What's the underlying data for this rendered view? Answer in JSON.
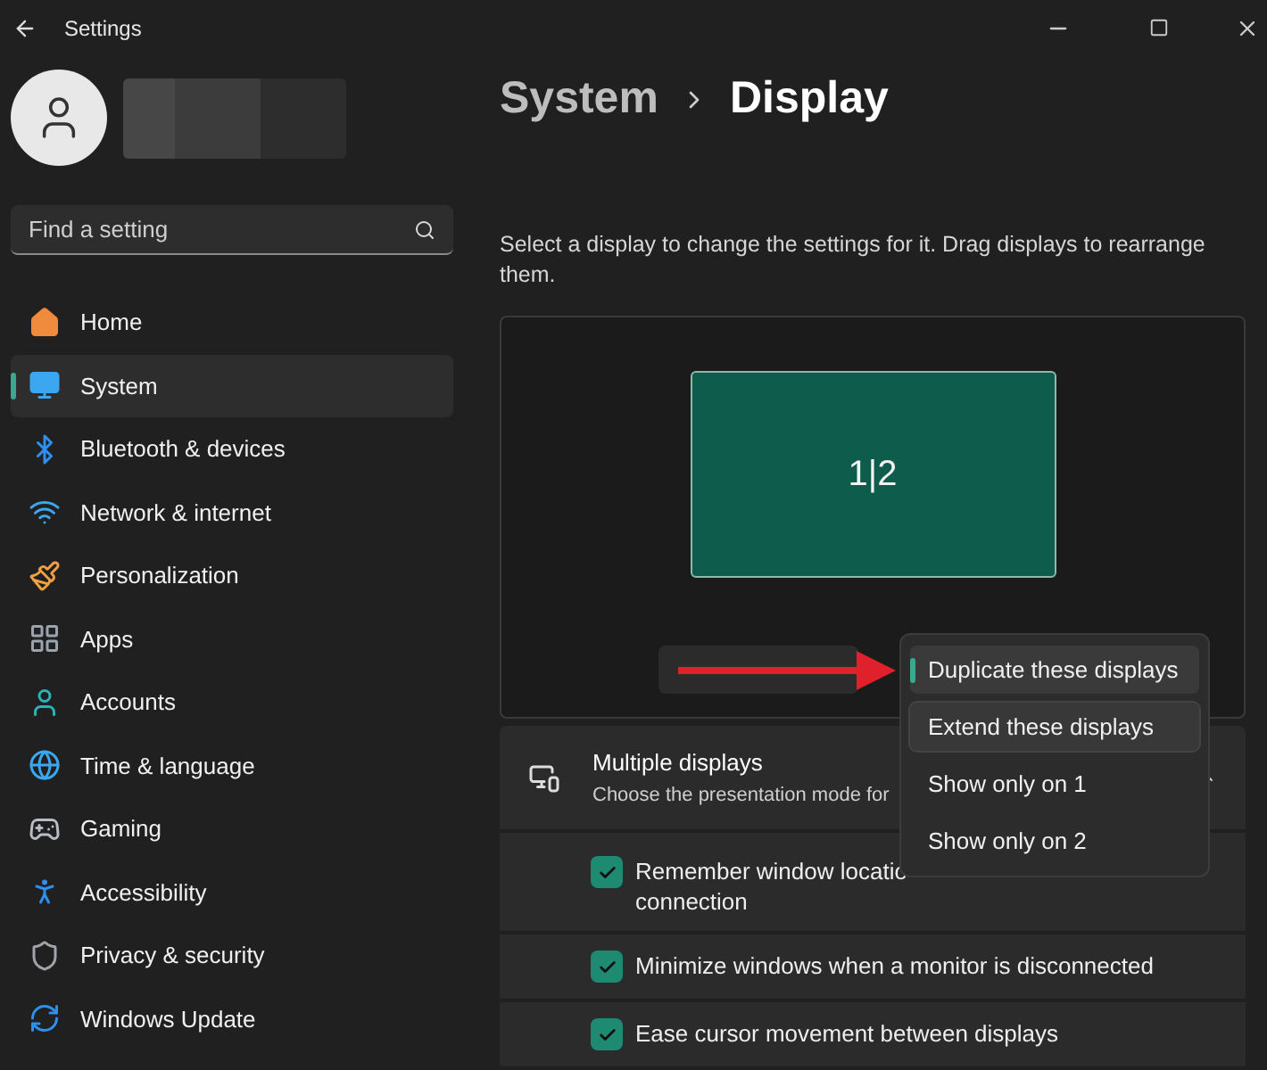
{
  "window": {
    "title": "Settings"
  },
  "search": {
    "placeholder": "Find a setting"
  },
  "sidebar": {
    "items": [
      {
        "label": "Home",
        "selected": false
      },
      {
        "label": "System",
        "selected": true
      },
      {
        "label": "Bluetooth & devices",
        "selected": false
      },
      {
        "label": "Network & internet",
        "selected": false
      },
      {
        "label": "Personalization",
        "selected": false
      },
      {
        "label": "Apps",
        "selected": false
      },
      {
        "label": "Accounts",
        "selected": false
      },
      {
        "label": "Time & language",
        "selected": false
      },
      {
        "label": "Gaming",
        "selected": false
      },
      {
        "label": "Accessibility",
        "selected": false
      },
      {
        "label": "Privacy & security",
        "selected": false
      },
      {
        "label": "Windows Update",
        "selected": false
      }
    ]
  },
  "breadcrumb": {
    "parent": "System",
    "current": "Display"
  },
  "description": "Select a display to change the settings for it. Drag displays to rearrange them.",
  "arrangement": {
    "monitor_label": "1|2"
  },
  "multiple_displays": {
    "title": "Multiple displays",
    "subtitle": "Choose the presentation mode for",
    "expanded": true
  },
  "options": [
    {
      "label": "Remember window locatio",
      "continuation": "connection",
      "checked": true
    },
    {
      "label": "Minimize windows when a monitor is disconnected",
      "checked": true
    },
    {
      "label": "Ease cursor movement between displays",
      "checked": true
    }
  ],
  "dropdown": {
    "items": [
      {
        "label": "Duplicate these displays",
        "selected": true,
        "hovered": false
      },
      {
        "label": "Extend these displays",
        "selected": false,
        "hovered": true
      },
      {
        "label": "Show only on 1",
        "selected": false,
        "hovered": false
      },
      {
        "label": "Show only on 2",
        "selected": false,
        "hovered": false
      }
    ]
  }
}
